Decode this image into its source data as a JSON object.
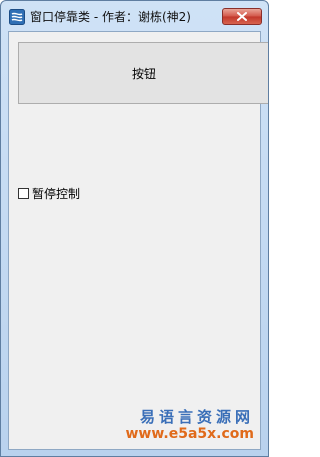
{
  "window": {
    "title": "窗口停靠类 - 作者：谢栋(神2)"
  },
  "main": {
    "button_label": "按钮",
    "checkbox": {
      "label": "暂停控制",
      "checked": false
    }
  },
  "watermark": {
    "title": "易语言资源网",
    "url": "www.e5a5x.com"
  },
  "icons": {
    "app": "app-icon",
    "close": "close-icon"
  },
  "colors": {
    "close_button": "#c2372b",
    "watermark_title": "#3a6fb8",
    "watermark_url": "#e06a1a"
  }
}
